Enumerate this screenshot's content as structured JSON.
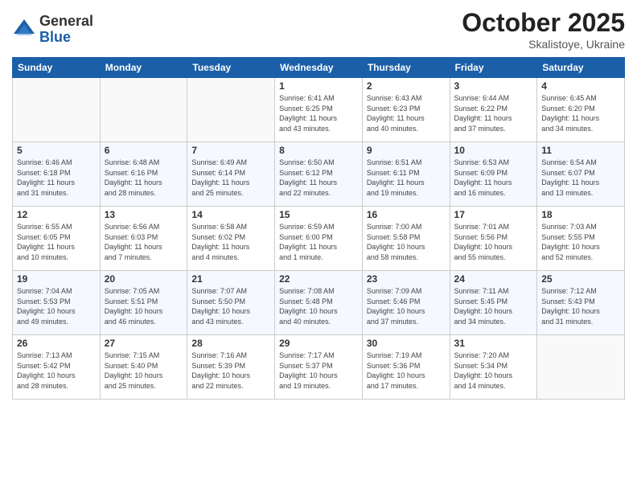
{
  "logo": {
    "general": "General",
    "blue": "Blue"
  },
  "title": "October 2025",
  "location": "Skalistoye, Ukraine",
  "days_of_week": [
    "Sunday",
    "Monday",
    "Tuesday",
    "Wednesday",
    "Thursday",
    "Friday",
    "Saturday"
  ],
  "weeks": [
    [
      {
        "day": "",
        "info": ""
      },
      {
        "day": "",
        "info": ""
      },
      {
        "day": "",
        "info": ""
      },
      {
        "day": "1",
        "info": "Sunrise: 6:41 AM\nSunset: 6:25 PM\nDaylight: 11 hours\nand 43 minutes."
      },
      {
        "day": "2",
        "info": "Sunrise: 6:43 AM\nSunset: 6:23 PM\nDaylight: 11 hours\nand 40 minutes."
      },
      {
        "day": "3",
        "info": "Sunrise: 6:44 AM\nSunset: 6:22 PM\nDaylight: 11 hours\nand 37 minutes."
      },
      {
        "day": "4",
        "info": "Sunrise: 6:45 AM\nSunset: 6:20 PM\nDaylight: 11 hours\nand 34 minutes."
      }
    ],
    [
      {
        "day": "5",
        "info": "Sunrise: 6:46 AM\nSunset: 6:18 PM\nDaylight: 11 hours\nand 31 minutes."
      },
      {
        "day": "6",
        "info": "Sunrise: 6:48 AM\nSunset: 6:16 PM\nDaylight: 11 hours\nand 28 minutes."
      },
      {
        "day": "7",
        "info": "Sunrise: 6:49 AM\nSunset: 6:14 PM\nDaylight: 11 hours\nand 25 minutes."
      },
      {
        "day": "8",
        "info": "Sunrise: 6:50 AM\nSunset: 6:12 PM\nDaylight: 11 hours\nand 22 minutes."
      },
      {
        "day": "9",
        "info": "Sunrise: 6:51 AM\nSunset: 6:11 PM\nDaylight: 11 hours\nand 19 minutes."
      },
      {
        "day": "10",
        "info": "Sunrise: 6:53 AM\nSunset: 6:09 PM\nDaylight: 11 hours\nand 16 minutes."
      },
      {
        "day": "11",
        "info": "Sunrise: 6:54 AM\nSunset: 6:07 PM\nDaylight: 11 hours\nand 13 minutes."
      }
    ],
    [
      {
        "day": "12",
        "info": "Sunrise: 6:55 AM\nSunset: 6:05 PM\nDaylight: 11 hours\nand 10 minutes."
      },
      {
        "day": "13",
        "info": "Sunrise: 6:56 AM\nSunset: 6:03 PM\nDaylight: 11 hours\nand 7 minutes."
      },
      {
        "day": "14",
        "info": "Sunrise: 6:58 AM\nSunset: 6:02 PM\nDaylight: 11 hours\nand 4 minutes."
      },
      {
        "day": "15",
        "info": "Sunrise: 6:59 AM\nSunset: 6:00 PM\nDaylight: 11 hours\nand 1 minute."
      },
      {
        "day": "16",
        "info": "Sunrise: 7:00 AM\nSunset: 5:58 PM\nDaylight: 10 hours\nand 58 minutes."
      },
      {
        "day": "17",
        "info": "Sunrise: 7:01 AM\nSunset: 5:56 PM\nDaylight: 10 hours\nand 55 minutes."
      },
      {
        "day": "18",
        "info": "Sunrise: 7:03 AM\nSunset: 5:55 PM\nDaylight: 10 hours\nand 52 minutes."
      }
    ],
    [
      {
        "day": "19",
        "info": "Sunrise: 7:04 AM\nSunset: 5:53 PM\nDaylight: 10 hours\nand 49 minutes."
      },
      {
        "day": "20",
        "info": "Sunrise: 7:05 AM\nSunset: 5:51 PM\nDaylight: 10 hours\nand 46 minutes."
      },
      {
        "day": "21",
        "info": "Sunrise: 7:07 AM\nSunset: 5:50 PM\nDaylight: 10 hours\nand 43 minutes."
      },
      {
        "day": "22",
        "info": "Sunrise: 7:08 AM\nSunset: 5:48 PM\nDaylight: 10 hours\nand 40 minutes."
      },
      {
        "day": "23",
        "info": "Sunrise: 7:09 AM\nSunset: 5:46 PM\nDaylight: 10 hours\nand 37 minutes."
      },
      {
        "day": "24",
        "info": "Sunrise: 7:11 AM\nSunset: 5:45 PM\nDaylight: 10 hours\nand 34 minutes."
      },
      {
        "day": "25",
        "info": "Sunrise: 7:12 AM\nSunset: 5:43 PM\nDaylight: 10 hours\nand 31 minutes."
      }
    ],
    [
      {
        "day": "26",
        "info": "Sunrise: 7:13 AM\nSunset: 5:42 PM\nDaylight: 10 hours\nand 28 minutes."
      },
      {
        "day": "27",
        "info": "Sunrise: 7:15 AM\nSunset: 5:40 PM\nDaylight: 10 hours\nand 25 minutes."
      },
      {
        "day": "28",
        "info": "Sunrise: 7:16 AM\nSunset: 5:39 PM\nDaylight: 10 hours\nand 22 minutes."
      },
      {
        "day": "29",
        "info": "Sunrise: 7:17 AM\nSunset: 5:37 PM\nDaylight: 10 hours\nand 19 minutes."
      },
      {
        "day": "30",
        "info": "Sunrise: 7:19 AM\nSunset: 5:36 PM\nDaylight: 10 hours\nand 17 minutes."
      },
      {
        "day": "31",
        "info": "Sunrise: 7:20 AM\nSunset: 5:34 PM\nDaylight: 10 hours\nand 14 minutes."
      },
      {
        "day": "",
        "info": ""
      }
    ]
  ]
}
